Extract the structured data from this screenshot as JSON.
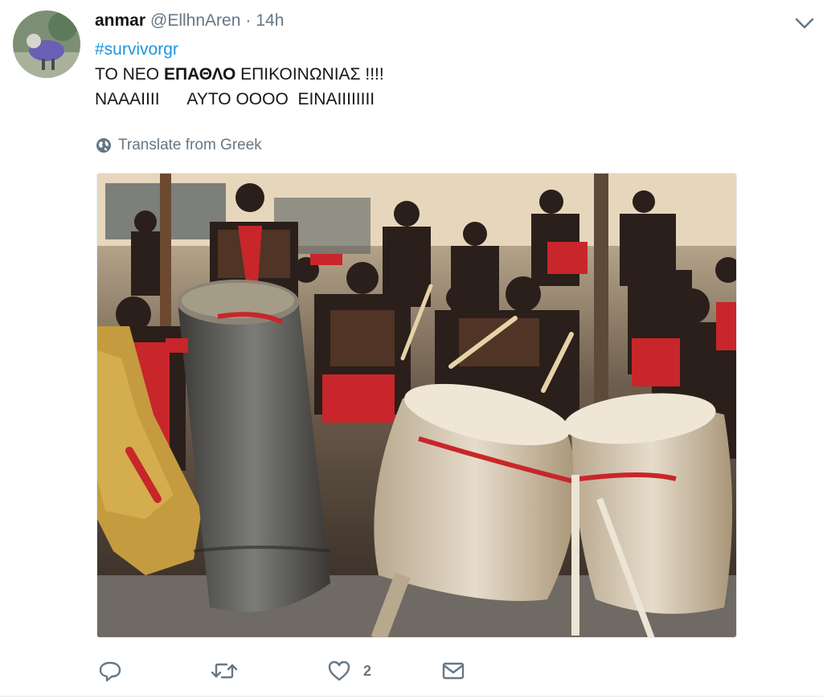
{
  "tweet": {
    "author_name": "anmar",
    "author_handle": "@EllhnAren",
    "separator": "·",
    "time": "14h",
    "hashtag": "#survivorgr",
    "line1_prefix": "ΤΟ ΝΕΟ ",
    "line1_bold": "ΕΠΑΘΛΟ",
    "line1_suffix": " ΕΠΙΚΟΙΝΩΝΙΑΣ !!!!",
    "line2": "ΝΑΑΑΙΙΙΙ      ΑΥΤΟ ΟΟΟΟ  ΕΙΝΑΙΙΙΙΙΙΙΙ",
    "translate_label": "Translate from Greek",
    "like_count": "2"
  },
  "icons": {
    "globe": "globe-icon",
    "reply": "reply-icon",
    "retweet": "retweet-icon",
    "like": "heart-icon",
    "message": "envelope-icon",
    "caret": "chevron-down-icon"
  },
  "colors": {
    "link": "#1b95e0",
    "secondary_text": "#657786",
    "primary_text": "#14171a",
    "drum_red": "#c8262a"
  }
}
